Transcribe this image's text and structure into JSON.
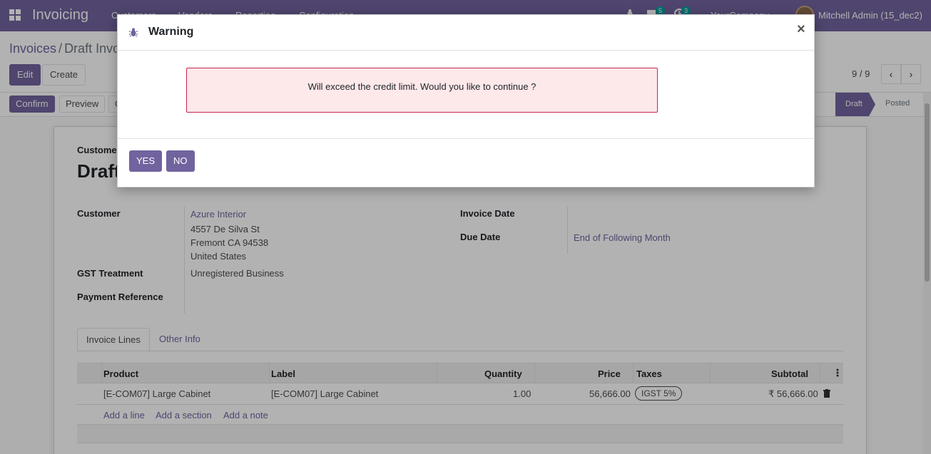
{
  "navbar": {
    "app_title": "Invoicing",
    "menus": [
      "Customers",
      "Vendors",
      "Reporting",
      "Configuration"
    ],
    "chat_badge": "5",
    "activity_badge": "3",
    "company": "YourCompany",
    "user": "Mitchell Admin (15_dec2)"
  },
  "breadcrumb": {
    "parent": "Invoices",
    "current": "Draft Invoice"
  },
  "actions": {
    "edit": "Edit",
    "create": "Create"
  },
  "pager": {
    "value": "9 / 9",
    "prev_icon": "‹",
    "next_icon": "›"
  },
  "status_actions": {
    "confirm": "Confirm",
    "preview": "Preview",
    "cancel": "C"
  },
  "stages": {
    "draft": "Draft",
    "posted": "Posted"
  },
  "form": {
    "type_label": "Customer Invoice",
    "title": "Draft",
    "customer_label": "Customer",
    "customer_name": "Azure Interior",
    "address_line1": "4557 De Silva St",
    "address_line2": "Fremont CA 94538",
    "address_line3": "United States",
    "gst_label": "GST Treatment",
    "gst_value": "Unregistered Business",
    "payment_ref_label": "Payment Reference",
    "invoice_date_label": "Invoice Date",
    "due_date_label": "Due Date",
    "due_date_value": "End of Following Month"
  },
  "tabs": [
    "Invoice Lines",
    "Other Info"
  ],
  "table": {
    "columns": [
      "Product",
      "Label",
      "Quantity",
      "Price",
      "Taxes",
      "Subtotal"
    ],
    "rows": [
      {
        "product": "[E-COM07] Large Cabinet",
        "label": "[E-COM07] Large Cabinet",
        "quantity": "1.00",
        "price": "56,666.00",
        "taxes": "IGST 5%",
        "subtotal": "₹ 56,666.00"
      }
    ],
    "add_line": "Add a line",
    "add_section": "Add a section",
    "add_note": "Add a note"
  },
  "modal": {
    "title": "Warning",
    "close": "×",
    "message": "Will exceed the credit limit. Would you like to continue ?",
    "yes": "YES",
    "no": "NO"
  },
  "colors": {
    "brand": "#71639e",
    "alert_bg": "#fde8ea",
    "alert_border": "#c7254e"
  }
}
